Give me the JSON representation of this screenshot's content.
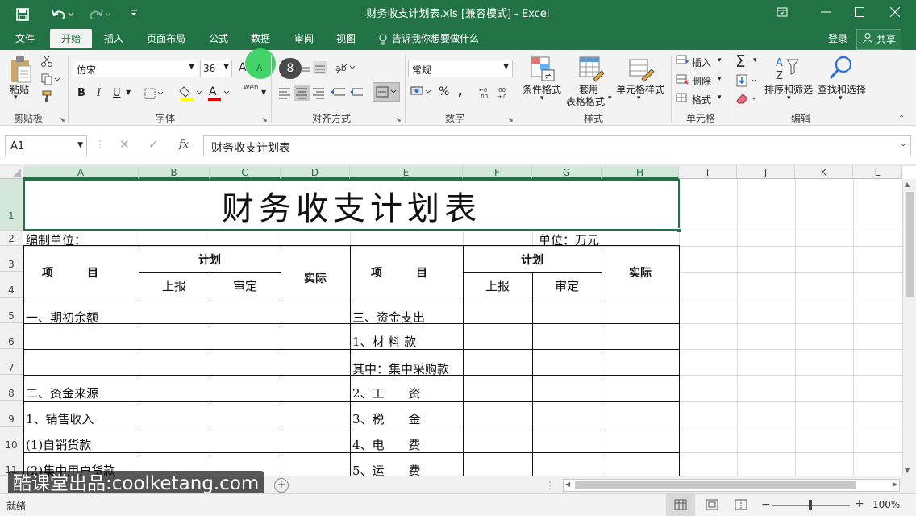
{
  "titlebar": {
    "doc_title": "财务收支计划表.xls  [兼容模式] - Excel",
    "undo_icon": "undo-icon",
    "redo_icon": "redo-icon",
    "save_icon": "save-icon"
  },
  "menu": {
    "items": [
      "文件",
      "开始",
      "插入",
      "页面布局",
      "公式",
      "数据",
      "审阅",
      "视图"
    ],
    "active": "开始",
    "tellme": "告诉我你想要做什么",
    "login": "登录",
    "share": "共享"
  },
  "ribbon": {
    "clipboard": {
      "paste": "粘贴",
      "group": "剪贴板"
    },
    "font": {
      "name": "仿宋",
      "size": "36",
      "group": "字体",
      "bold": "B",
      "italic": "I",
      "underline": "U",
      "wen": "wén",
      "grow": "A",
      "shrink": "A"
    },
    "alignment": {
      "group": "对齐方式"
    },
    "number": {
      "format": "常规",
      "group": "数字",
      "percent": "%",
      "comma": ","
    },
    "styles": {
      "conditional": "条件格式",
      "table_line1": "套用",
      "table_line2": "表格格式",
      "cell_styles": "单元格样式",
      "group": "样式"
    },
    "cells": {
      "insert": "插入",
      "delete": "删除",
      "format": "格式",
      "group": "单元格"
    },
    "editing": {
      "sort": "排序和筛选",
      "find": "查找和选择",
      "group": "编辑",
      "sigma": "Σ"
    },
    "cursor_badge": "8"
  },
  "formulabar": {
    "namebox": "A1",
    "content": "财务收支计划表",
    "fx": "fx"
  },
  "columns": [
    "A",
    "B",
    "C",
    "D",
    "E",
    "F",
    "G",
    "H",
    "I",
    "J",
    "K",
    "L"
  ],
  "rows": [
    "1",
    "2",
    "3",
    "4",
    "5",
    "6",
    "7",
    "8",
    "9",
    "10",
    "11"
  ],
  "sheet": {
    "title": "财务收支计划表",
    "unit_left": "编制单位：",
    "unit_right": "单位：万元",
    "h_item1": "项　　　目",
    "h_plan1": "计划",
    "h_actual1": "实际",
    "h_item2": "项　　　目",
    "h_plan2": "计划",
    "h_actual2": "实际",
    "h_report1": "上报",
    "h_approve1": "审定",
    "h_report2": "上报",
    "h_approve2": "审定",
    "left_items": [
      "一、期初余额",
      "",
      "",
      "二、资金来源",
      "1、销售收入",
      "(1)自销货款",
      "(2)集中用户货款"
    ],
    "right_items": [
      "三、资金支出",
      "1、材 料 款",
      "其中：集中采购款",
      "2、工　　资",
      "3、税　　金",
      "4、电　　费",
      "5、运　　费"
    ]
  },
  "status": {
    "ready": "就绪",
    "zoom": "100%"
  },
  "watermark": "酷课堂出品:coolketang.com"
}
